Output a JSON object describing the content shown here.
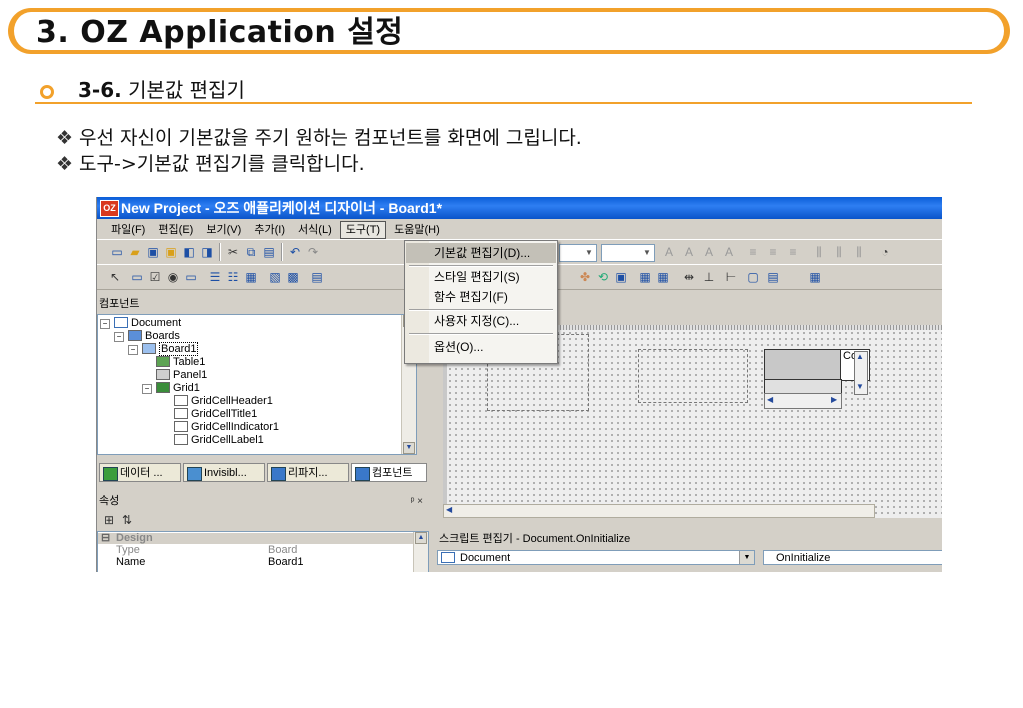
{
  "slide": {
    "title": "3. OZ Application 설정",
    "subtitle_num": "3-6.",
    "subtitle_text": "기본값 편집기",
    "bullets": [
      "우선 자신이 기본값을 주기 원하는 컴포넌트를 화면에 그립니다.",
      "도구->기본값 편집기를 클릭합니다."
    ],
    "bullet_glyph": "❖"
  },
  "window": {
    "app_icon": "OZ",
    "title": "New Project - 오즈 애플리케이션 디자이너 - Board1*",
    "menus": [
      "파일(F)",
      "편집(E)",
      "보기(V)",
      "추가(I)",
      "서식(L)",
      "도구(T)",
      "도움말(H)"
    ],
    "active_menu": "도구(T)",
    "tools_menu": {
      "items": [
        "기본값 편집기(D)...",
        "스타일 편집기(S)",
        "함수 편집기(F)",
        "사용자 지정(C)...",
        "옵션(O)..."
      ],
      "highlighted": "기본값 편집기(D)..."
    }
  },
  "component_panel": {
    "title": "컴포넌트",
    "pin_glyph": "ᵖ",
    "tree": [
      {
        "label": "Document",
        "expander": "−"
      },
      {
        "label": "Boards",
        "expander": "−"
      },
      {
        "label": "Board1",
        "expander": "−"
      },
      {
        "label": "Table1"
      },
      {
        "label": "Panel1"
      },
      {
        "label": "Grid1",
        "expander": "−"
      },
      {
        "label": "GridCellHeader1"
      },
      {
        "label": "GridCellTitle1"
      },
      {
        "label": "GridCellIndicator1"
      },
      {
        "label": "GridCellLabel1"
      }
    ],
    "tabs": [
      "데이터 ...",
      "Invisibl...",
      "리파지...",
      "컴포넌트"
    ]
  },
  "property_panel": {
    "title": "속성",
    "close_glyph": "ᵖ ×",
    "section": "Design",
    "rows": [
      {
        "key": "Type",
        "value": "Board"
      },
      {
        "key": "Name",
        "value": "Board1"
      }
    ]
  },
  "script_editor": {
    "title": "스크립트 편집기 - Document.OnInitialize",
    "object": "Document",
    "event": "OnInitialize"
  },
  "canvas": {
    "grid_cell_text": "Co"
  }
}
